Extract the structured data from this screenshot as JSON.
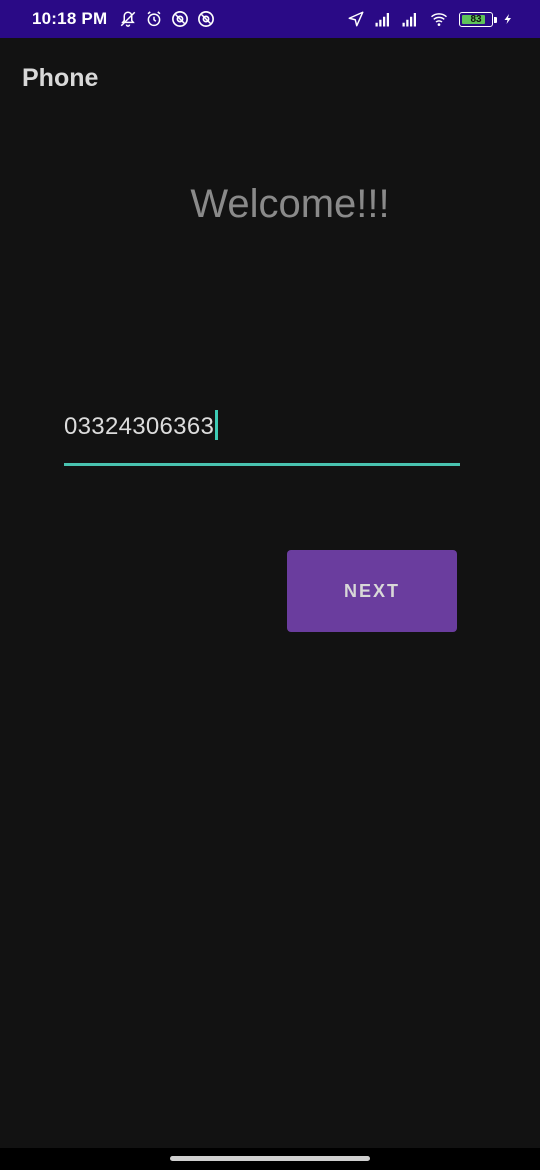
{
  "status_bar": {
    "time": "10:18 PM",
    "battery_level": "83",
    "battery_fraction": 0.83,
    "left_icons": [
      "notifications-off-icon",
      "alarm-icon",
      "at-sign-icon",
      "at-sign-icon"
    ],
    "right_icons": [
      "location-arrow-icon",
      "signal-icon",
      "signal-icon",
      "wifi-icon",
      "battery-icon",
      "charging-bolt-icon"
    ],
    "background": "#2a0a86"
  },
  "app_bar": {
    "title": "Phone"
  },
  "main": {
    "welcome_text": "Welcome!!!",
    "phone_input": {
      "value": "03324306363",
      "accent_color": "#49c3b0"
    },
    "next_button": {
      "label": "NEXT",
      "color": "#6a3d9e"
    }
  },
  "theme": {
    "background": "#121212"
  }
}
